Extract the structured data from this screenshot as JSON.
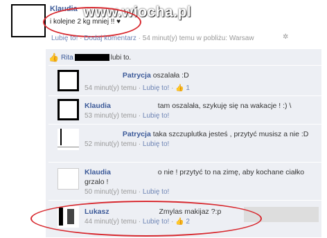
{
  "post": {
    "author": "Klaudia",
    "status": "i kolejne 2 kg mniej !! ♥",
    "watermark": "www.wiocha.pl",
    "like_link": "Lubię to!",
    "comment_link": "Dodaj komentarz",
    "time": "54 minut(y) temu w pobliżu: Warsaw",
    "separator": "·"
  },
  "likes": {
    "prefix": "Rita",
    "suffix": "lubi to."
  },
  "comments": [
    {
      "name": "Patrycja",
      "text": "oszalała :D",
      "time": "54 minut(y) temu",
      "like_label": "Lubię to!",
      "like_count": "1"
    },
    {
      "name": "Klaudia",
      "text": "tam oszalała, szykuję się na wakacje ! :) \\",
      "time": "53 minut(y) temu",
      "like_label": "Lubię to!",
      "like_count": ""
    },
    {
      "name": "Patrycja",
      "text": "taka szczuplutka jesteś , przytyć musisz a nie :D",
      "time": "52 minut(y) temu",
      "like_label": "Lubię to!",
      "like_count": ""
    },
    {
      "name": "Klaudia",
      "text": "o nie ! przytyć to na zimę, aby kochane ciałko grzalo !",
      "time": "50 minut(y) temu",
      "like_label": "Lubię to!",
      "like_count": ""
    },
    {
      "name": "Lukasz",
      "text": "Zmylas makijaz ?:p",
      "time": "44 minut(y) temu",
      "like_label": "Lubię to!",
      "like_count": "2"
    }
  ],
  "icons": {
    "like": "thumbs-up-icon",
    "gear": "gear-icon"
  }
}
